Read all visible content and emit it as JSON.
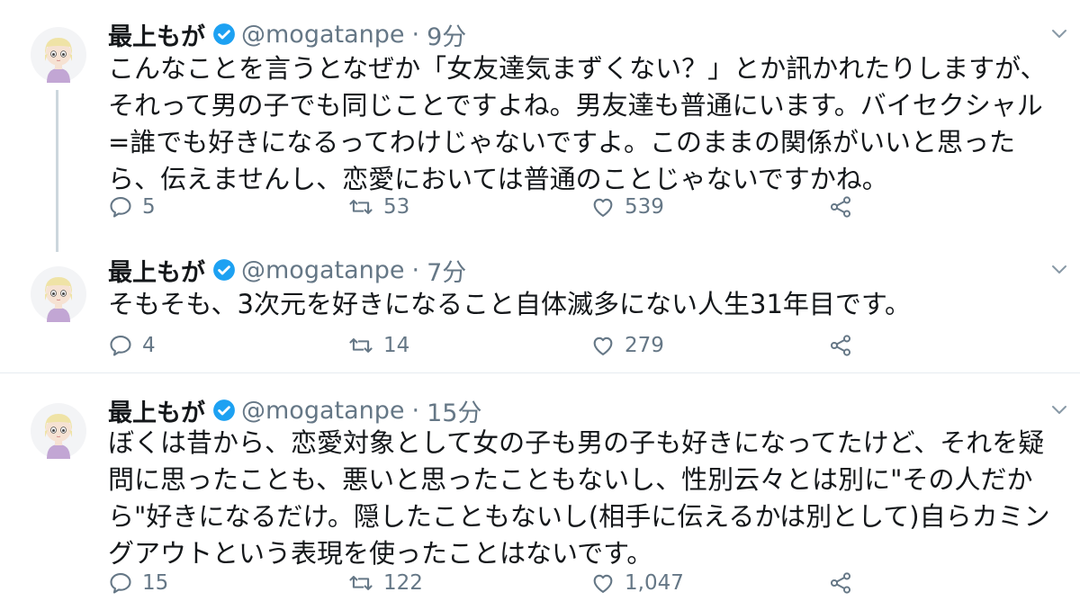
{
  "tweets": [
    {
      "name": "最上もが",
      "handle": "@mogatanpe",
      "separator": "·",
      "time": "9分",
      "text": "こんなことを言うとなぜか「女友達気まずくない？」とか訊かれたりしますが、それって男の子でも同じことですよね。男友達も普通にいます。バイセクシャル=誰でも好きになるってわけじゃないですよ。このままの関係がいいと思ったら、伝えませんし、恋愛においては普通のことじゃないですかね。",
      "replies": "5",
      "retweets": "53",
      "likes": "539"
    },
    {
      "name": "最上もが",
      "handle": "@mogatanpe",
      "separator": "·",
      "time": "7分",
      "text": "そもそも、3次元を好きになること自体滅多にない人生31年目です。",
      "replies": "4",
      "retweets": "14",
      "likes": "279"
    },
    {
      "name": "最上もが",
      "handle": "@mogatanpe",
      "separator": "·",
      "time": "15分",
      "text": "ぼくは昔から、恋愛対象として女の子も男の子も好きになってたけど、それを疑問に思ったことも、悪いと思ったこともないし、性別云々とは別に\"その人だから\"好きになるだけ。隠したこともないし(相手に伝えるかは別として)自らカミングアウトという表現を使ったことはないです。",
      "replies": "15",
      "retweets": "122",
      "likes": "1,047"
    }
  ],
  "colors": {
    "text": "#14171a",
    "secondary": "#657786",
    "verified": "#1da1f2",
    "thread_line": "#ccd6dd",
    "divider": "#e6ecf0"
  },
  "icons": [
    "verified-badge-icon",
    "reply-icon",
    "retweet-icon",
    "like-icon",
    "share-icon",
    "chevron-down-icon"
  ]
}
